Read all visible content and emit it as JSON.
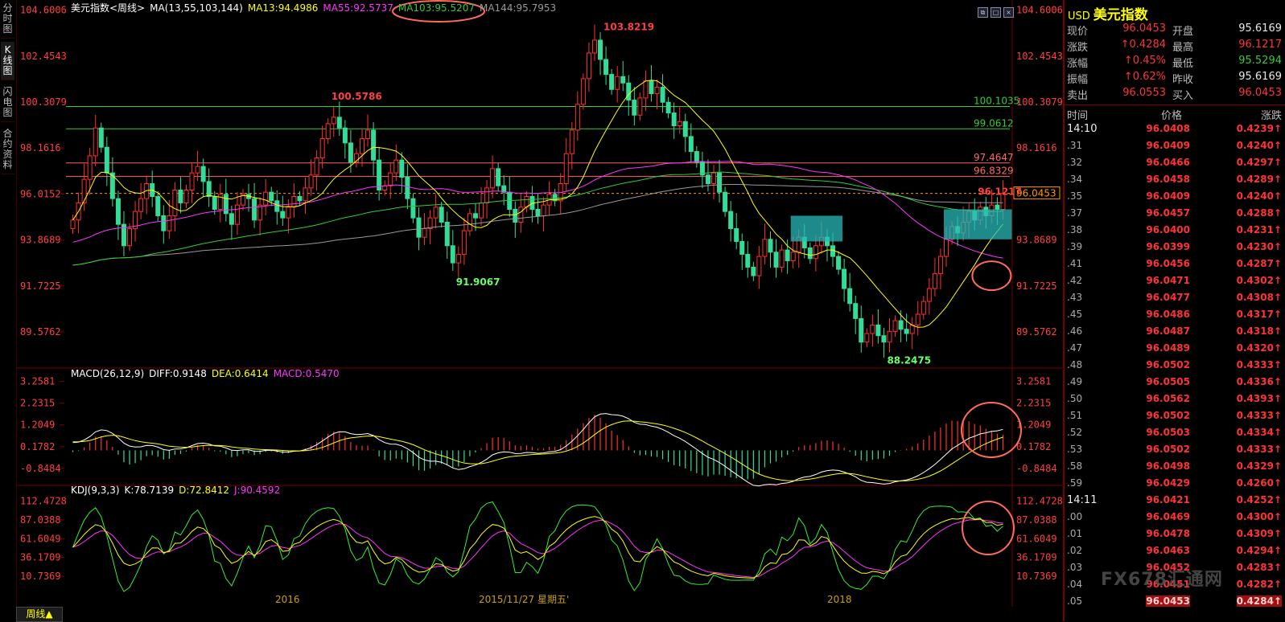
{
  "sidebar_tabs": [
    "分时图",
    "K线图",
    "闪电图",
    "合约资料"
  ],
  "active_tab_index": 1,
  "window_icons": [
    "restore-icon",
    "maximize-icon",
    "close-icon"
  ],
  "period_label": "周线▲",
  "chart_data": [
    {
      "type": "candlestick",
      "title": "美元指数<周线>",
      "indicator_label": "MA(13,55,103,144)",
      "ma_values": [
        {
          "name": "MA13:94.4986",
          "color": "#ffff00"
        },
        {
          "name": "MA55:92.5737",
          "color": "#ff33ff"
        },
        {
          "name": "MA103:95.5207",
          "color": "#33cc33"
        },
        {
          "name": "MA144:95.7953",
          "color": "#999999"
        }
      ],
      "y_ticks": [
        104.6006,
        102.4543,
        100.3079,
        98.1616,
        96.0152,
        93.8689,
        91.7225,
        89.5762
      ],
      "y_tick_labels": [
        "104.6006",
        "102.4543",
        "100.3079",
        "98.1616",
        "96.0152",
        "93.8689",
        "91.7225",
        "89.5762"
      ],
      "ylim": [
        88.0,
        104.7
      ],
      "x_labels": [
        "2016",
        "2015/11/27 星期五'",
        "2018"
      ],
      "hlines": [
        {
          "value": 100.1035,
          "label": "100.1035",
          "color": "#33cc33"
        },
        {
          "value": 99.0612,
          "label": "99.0612",
          "color": "#33cc33"
        },
        {
          "value": 97.4647,
          "label": "97.4647",
          "color": "#ff6666"
        },
        {
          "value": 96.8329,
          "label": "96.8329",
          "color": "#ff6666"
        }
      ],
      "current_price_label": "96.0453",
      "current_price": 96.0453,
      "annotations": [
        "103.8219",
        "100.5786",
        "91.9067",
        "88.2475",
        "96.1217"
      ],
      "close_series": [
        94.8,
        95.6,
        96.7,
        97.8,
        99.1,
        98.2,
        97.0,
        95.8,
        94.6,
        93.6,
        94.4,
        95.2,
        95.8,
        96.5,
        95.9,
        95.0,
        94.3,
        95.0,
        96.2,
        95.6,
        96.2,
        97.0,
        97.3,
        96.6,
        95.9,
        95.3,
        96.0,
        95.1,
        94.6,
        95.5,
        96.0,
        95.8,
        94.8,
        95.5,
        96.1,
        95.7,
        95.2,
        94.9,
        95.4,
        95.9,
        95.7,
        96.3,
        96.9,
        97.7,
        98.6,
        99.3,
        99.6,
        99.1,
        98.4,
        97.5,
        97.9,
        98.6,
        99.0,
        97.6,
        96.2,
        96.4,
        97.0,
        97.6,
        96.8,
        95.8,
        94.9,
        94.0,
        94.4,
        94.9,
        95.4,
        94.7,
        93.6,
        92.8,
        93.2,
        94.3,
        95.1,
        94.9,
        95.6,
        96.3,
        97.2,
        96.4,
        96.1,
        95.3,
        94.7,
        95.4,
        95.9,
        95.3,
        95.0,
        95.5,
        96.0,
        95.7,
        96.5,
        97.9,
        99.0,
        100.2,
        101.4,
        102.6,
        103.2,
        102.3,
        101.6,
        100.9,
        101.5,
        101.2,
        100.4,
        99.7,
        100.5,
        101.3,
        100.7,
        101.0,
        100.3,
        99.8,
        99.2,
        99.4,
        98.7,
        98.0,
        97.5,
        96.9,
        96.5,
        97.0,
        96.1,
        95.2,
        94.4,
        93.8,
        93.2,
        92.6,
        92.2,
        93.1,
        93.9,
        93.3,
        92.6,
        93.4,
        92.9,
        93.3,
        94.0,
        93.5,
        93.0,
        93.6,
        94.0,
        93.6,
        93.1,
        92.5,
        91.6,
        90.9,
        90.2,
        89.1,
        89.5,
        89.9,
        89.4,
        89.1,
        89.6,
        90.1,
        89.7,
        89.5,
        89.9,
        90.4,
        91.0,
        91.6,
        92.3,
        93.1,
        93.9,
        94.5,
        94.2,
        94.7,
        95.2,
        94.8,
        95.4,
        95.0,
        95.5,
        95.3,
        96.0453
      ],
      "macd": {
        "label": "MACD(26,12,9)",
        "diff_label": "DIFF:0.9148",
        "dea_label": "DEA:0.6414",
        "macd_label": "MACD:0.5470",
        "y_tick_labels": [
          "3.2581",
          "2.2315",
          "1.2049",
          "0.1782",
          "-0.8484"
        ],
        "y_ticks": [
          3.2581,
          2.2315,
          1.2049,
          0.1782,
          -0.8484
        ],
        "ylim": [
          -1.5,
          3.7
        ]
      },
      "kdj": {
        "label": "KDJ(9,3,3)",
        "k_label": "K:78.7139",
        "d_label": "D:72.8412",
        "j_label": "J:90.4592",
        "y_tick_labels": [
          "112.4728",
          "87.0388",
          "61.6049",
          "36.1709",
          "10.7369"
        ],
        "y_ticks": [
          112.4728,
          87.0388,
          61.6049,
          36.1709,
          10.7369
        ],
        "ylim": [
          -12,
          125
        ]
      }
    }
  ],
  "quote": {
    "code": "USD",
    "name": "美元指数",
    "rows": [
      {
        "l1": "现价",
        "v1": "96.0453",
        "c1": "red",
        "l2": "开盘",
        "v2": "95.6169",
        "c2": "white"
      },
      {
        "l1": "涨跌",
        "v1": "↑0.4284",
        "c1": "red",
        "l2": "最高",
        "v2": "96.1217",
        "c2": "red"
      },
      {
        "l1": "涨幅",
        "v1": "↑0.45%",
        "c1": "red",
        "l2": "最低",
        "v2": "95.5294",
        "c2": "green"
      },
      {
        "l1": "振幅",
        "v1": "↑0.62%",
        "c1": "red",
        "l2": "昨收",
        "v2": "95.6169",
        "c2": "white"
      },
      {
        "l1": "卖出",
        "v1": "96.0553",
        "c1": "red",
        "l2": "买入",
        "v2": "96.0453",
        "c2": "red"
      }
    ],
    "tick_headers": [
      "时间",
      "价格",
      "涨跌"
    ],
    "ticks": [
      {
        "t": "14:10",
        "p": "96.0408",
        "c": "0.4239↑",
        "big": true
      },
      {
        "t": ".31",
        "p": "96.0409",
        "c": "0.4240↑"
      },
      {
        "t": ".32",
        "p": "96.0466",
        "c": "0.4297↑"
      },
      {
        "t": ".34",
        "p": "96.0458",
        "c": "0.4289↑"
      },
      {
        "t": ".35",
        "p": "96.0409",
        "c": "0.4240↑"
      },
      {
        "t": ".37",
        "p": "96.0457",
        "c": "0.4288↑"
      },
      {
        "t": ".38",
        "p": "96.0400",
        "c": "0.4231↑"
      },
      {
        "t": ".39",
        "p": "96.0399",
        "c": "0.4230↑"
      },
      {
        "t": ".41",
        "p": "96.0456",
        "c": "0.4287↑"
      },
      {
        "t": ".42",
        "p": "96.0471",
        "c": "0.4302↑"
      },
      {
        "t": ".43",
        "p": "96.0477",
        "c": "0.4308↑"
      },
      {
        "t": ".45",
        "p": "96.0486",
        "c": "0.4317↑"
      },
      {
        "t": ".46",
        "p": "96.0487",
        "c": "0.4318↑"
      },
      {
        "t": ".47",
        "p": "96.0489",
        "c": "0.4320↑"
      },
      {
        "t": ".48",
        "p": "96.0502",
        "c": "0.4333↑"
      },
      {
        "t": ".49",
        "p": "96.0505",
        "c": "0.4336↑"
      },
      {
        "t": ".50",
        "p": "96.0562",
        "c": "0.4393↑"
      },
      {
        "t": ".51",
        "p": "96.0502",
        "c": "0.4333↑"
      },
      {
        "t": ".52",
        "p": "96.0503",
        "c": "0.4334↑"
      },
      {
        "t": ".53",
        "p": "96.0502",
        "c": "0.4333↑"
      },
      {
        "t": ".58",
        "p": "96.0498",
        "c": "0.4329↑"
      },
      {
        "t": ".59",
        "p": "96.0429",
        "c": "0.4260↑"
      },
      {
        "t": "14:11",
        "p": "96.0421",
        "c": "0.4252↑",
        "big": true
      },
      {
        "t": ".00",
        "p": "96.0469",
        "c": "0.4300↑"
      },
      {
        "t": ".01",
        "p": "96.0478",
        "c": "0.4309↑"
      },
      {
        "t": ".02",
        "p": "96.0463",
        "c": "0.4294↑"
      },
      {
        "t": ".03",
        "p": "96.0452",
        "c": "0.4283↑"
      },
      {
        "t": ".04",
        "p": "96.0451",
        "c": "0.4282↑"
      },
      {
        "t": ".05",
        "p": "96.0453",
        "c": "0.4284↑"
      }
    ]
  },
  "watermark": "FX678汇通网"
}
